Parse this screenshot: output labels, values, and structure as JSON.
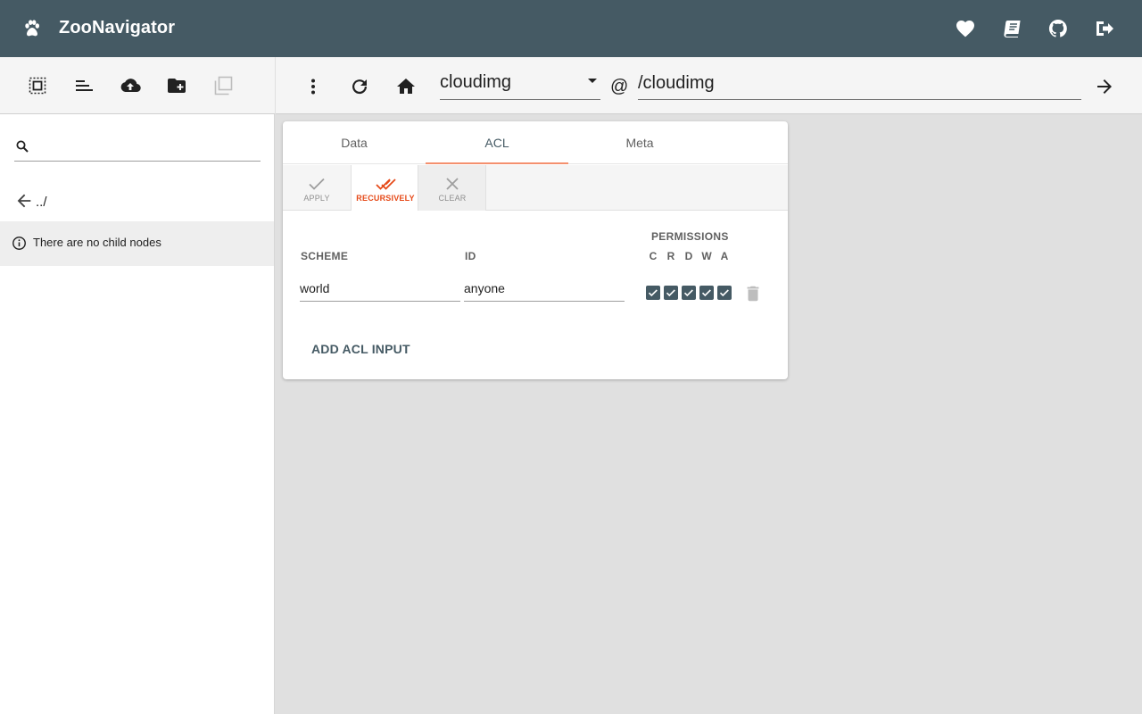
{
  "app": {
    "title": "ZooNavigator",
    "brand_color": "#455a64",
    "accent_color": "#e64a19"
  },
  "header": {
    "icons": [
      "paw-icon",
      "heart-icon",
      "book-icon",
      "github-icon",
      "logout-icon"
    ]
  },
  "sidebar": {
    "toolbar_icons": [
      "select-all-icon",
      "sort-icon",
      "upload-icon",
      "create-folder-icon",
      "duplicate-icon"
    ],
    "search": {
      "value": "",
      "placeholder": ""
    },
    "parent_link": "../",
    "empty_message": "There are no child nodes"
  },
  "toolbar": {
    "connection": "cloudimg",
    "at_sign": "@",
    "path": "/cloudimg"
  },
  "tabs": [
    {
      "label": "Data",
      "active": false
    },
    {
      "label": "ACL",
      "active": true
    },
    {
      "label": "Meta",
      "active": false
    }
  ],
  "actions": [
    {
      "label": "APPLY"
    },
    {
      "label": "RECURSIVELY"
    },
    {
      "label": "CLEAR"
    }
  ],
  "acl": {
    "headers": {
      "scheme": "SCHEME",
      "id": "ID",
      "permissions": "PERMISSIONS"
    },
    "permission_letters": [
      "C",
      "R",
      "D",
      "W",
      "A"
    ],
    "rows": [
      {
        "scheme": "world",
        "id": "anyone",
        "permissions": [
          true,
          true,
          true,
          true,
          true
        ]
      }
    ],
    "add_label": "ADD ACL INPUT"
  }
}
